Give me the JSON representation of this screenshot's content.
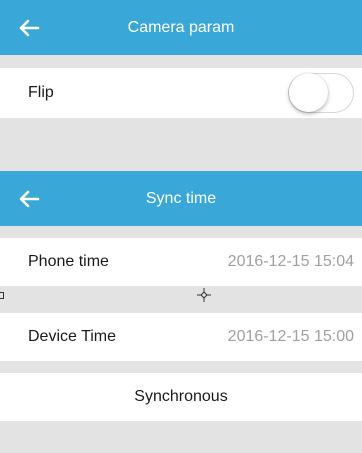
{
  "camera_param": {
    "title": "Camera param",
    "back_icon": "arrow-left-icon",
    "flip_label": "Flip",
    "flip_enabled": false
  },
  "sync_time": {
    "title": "Sync time",
    "back_icon": "arrow-left-icon",
    "phone_time_label": "Phone time",
    "phone_time_value": "2016-12-15 15:04",
    "device_time_label": "Device Time",
    "device_time_value": "2016-12-15 15:00",
    "sync_button_label": "Synchronous"
  },
  "colors": {
    "nav_bar": "#39a7d8",
    "background": "#e3e3e4",
    "value_text": "#a0a0a0"
  }
}
